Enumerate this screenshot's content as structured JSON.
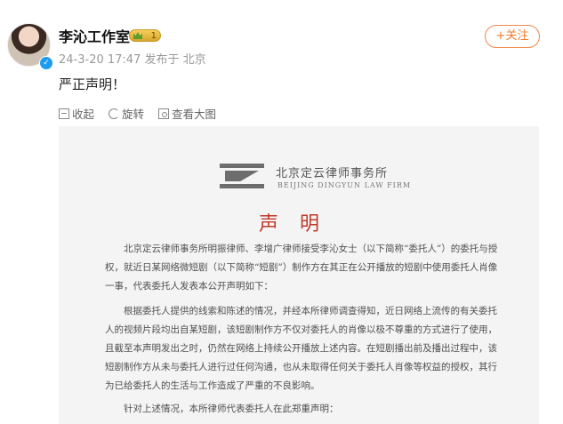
{
  "user": {
    "name": "李沁工作室",
    "badge_level": "1"
  },
  "meta": {
    "timestamp": "24-3-20 17:47",
    "published_from": "发布于 北京"
  },
  "follow_label": "+关注",
  "post_text": "严正声明！",
  "actions": {
    "collapse": "收起",
    "rotate": "旋转",
    "view_full": "查看大图"
  },
  "document": {
    "firm_name_cn": "北京定云律师事务所",
    "firm_name_en": "BEIJING DINGYUN LAW FIRM",
    "title": "声明",
    "paragraph1": "北京定云律师事务所明振律师、李增广律师接受李沁女士（以下简称“委托人”）的委托与授权，就近日某网络微短剧（以下简称“短剧”）制作方在其正在公开播放的短剧中使用委托人肖像一事，代表委托人发表本公开声明如下：",
    "paragraph2": "根据委托人提供的线索和陈述的情况，并经本所律师调查得知，近日网络上流传的有关委托人的视频片段均出自某短剧，该短剧制作方不仅对委托人的肖像以极不尊重的方式进行了使用，且截至本声明发出之时，仍然在网络上持续公开播放上述内容。在短剧播出前及播出过程中，该短剧制作方从未与委托人进行过任何沟通，也从未取得任何关于委托人肖像等权益的授权，其行为已给委托人的生活与工作造成了严重的不良影响。",
    "paragraph3": "针对上述情况，本所律师代表委托人在此郑重声明："
  },
  "colors": {
    "follow": "#f07b2a",
    "verify": "#1d9bf0",
    "title_red": "#c0392b"
  }
}
